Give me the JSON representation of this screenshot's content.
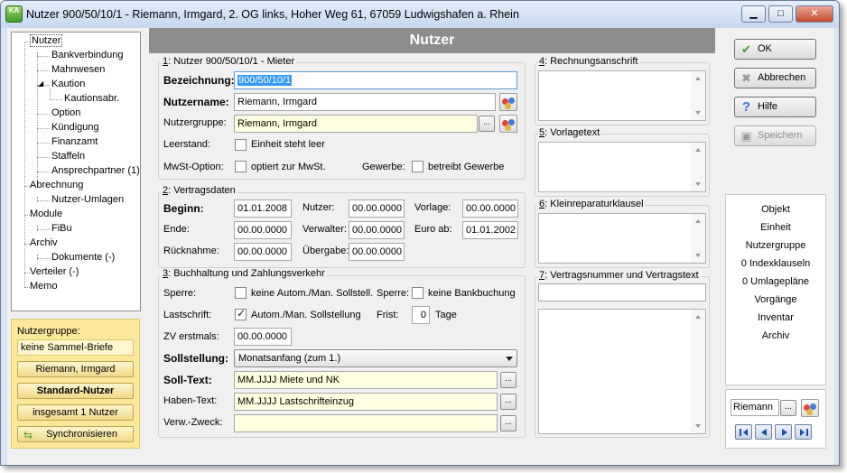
{
  "window": {
    "title": "Nutzer 900/50/10/1 - Riemann, Irmgard, 2. OG links, Hoher Weg 61, 67059 Ludwigshafen a. Rhein",
    "app_icon_text": "KA",
    "minimize": "▁",
    "maximize": "□",
    "close": "✕"
  },
  "tree": {
    "items": [
      {
        "label": "Nutzer",
        "level": 0
      },
      {
        "label": "Bankverbindung",
        "level": 1
      },
      {
        "label": "Mahnwesen",
        "level": 1
      },
      {
        "label": "Kaution",
        "level": 1
      },
      {
        "label": "Kautionsabr.",
        "level": 2
      },
      {
        "label": "Option",
        "level": 1
      },
      {
        "label": "Kündigung",
        "level": 1
      },
      {
        "label": "Finanzamt",
        "level": 1
      },
      {
        "label": "Staffeln",
        "level": 1
      },
      {
        "label": "Ansprechpartner (1)",
        "level": 1
      },
      {
        "label": "Abrechnung",
        "level": 0
      },
      {
        "label": "Nutzer-Umlagen",
        "level": 1
      },
      {
        "label": "Module",
        "level": 0
      },
      {
        "label": "FiBu",
        "level": 1
      },
      {
        "label": "Archiv",
        "level": 0
      },
      {
        "label": "Dokumente (-)",
        "level": 1
      },
      {
        "label": "Verteiler (-)",
        "level": 0
      },
      {
        "label": "Memo",
        "level": 0
      }
    ],
    "expander": "◢"
  },
  "nutzergruppe_panel": {
    "label": "Nutzergruppe:",
    "sammel_briefe": "keine Sammel-Briefe",
    "riemann_button": "Riemann, Irmgard",
    "standard_button": "Standard-Nutzer",
    "insgesamt_button": "insgesamt 1 Nutzer",
    "sync_button": "Synchronisieren"
  },
  "main": {
    "header": "Nutzer",
    "section1": {
      "title_num": "1",
      "title_rest": ": Nutzer 900/50/10/1 - Mieter",
      "bezeichnung_label": "Bezeichnung:",
      "bezeichnung_value": "900/50/10/1",
      "nutzername_label": "Nutzername:",
      "nutzername_value": "Riemann, Irmgard",
      "nutzergruppe_label": "Nutzergruppe:",
      "nutzergruppe_value": "Riemann, Irmgard",
      "leerstand_label": "Leerstand:",
      "leerstand_cb": "Einheit steht leer",
      "mwst_label": "MwSt-Option:",
      "mwst_cb": "optiert zur MwSt.",
      "gewerbe_label": "Gewerbe:",
      "gewerbe_cb": "betreibt Gewerbe"
    },
    "section2": {
      "title_num": "2",
      "title_rest": ": Vertragsdaten",
      "beginn_label": "Beginn:",
      "beginn_value": "01.01.2008",
      "ende_label": "Ende:",
      "ende_value": "00.00.0000",
      "ruecknahme_label": "Rücknahme:",
      "ruecknahme_value": "00.00.0000",
      "nutzer_label": "Nutzer:",
      "nutzer_value": "00.00.0000",
      "verwalter_label": "Verwalter:",
      "verwalter_value": "00.00.0000",
      "uebergabe_label": "Übergabe:",
      "uebergabe_value": "00.00.0000",
      "vorlage_label": "Vorlage:",
      "vorlage_value": "00.00.0000",
      "euro_label": "Euro ab:",
      "euro_value": "01.01.2002"
    },
    "section3": {
      "title_num": "3",
      "title_rest": ": Buchhaltung und Zahlungsverkehr",
      "sperre_label": "Sperre:",
      "sperre_cb": "keine Autom./Man. Sollstell.",
      "sperre2_label": "Sperre:",
      "sperre2_cb": "keine Bankbuchung",
      "lastschrift_label": "Lastschrift:",
      "lastschrift_cb": "Autom./Man. Sollstellung",
      "frist_label": "Frist:",
      "frist_value": "0",
      "tage_label": "Tage",
      "zv_label": "ZV erstmals:",
      "zv_value": "00.00.0000",
      "sollstellung_label": "Sollstellung:",
      "sollstellung_value": "Monatsanfang (zum 1.)",
      "soll_label": "Soll-Text:",
      "soll_value": "MM.JJJJ Miete und NK",
      "haben_label": "Haben-Text:",
      "haben_value": "MM.JJJJ Lastschrifteinzug",
      "verw_label": "Verw.-Zweck:",
      "verw_value": ""
    },
    "dots": "...",
    "section4": {
      "title_num": "4",
      "title_rest": ": Rechnungsanschrift"
    },
    "section5": {
      "title_num": "5",
      "title_rest": ": Vorlagetext"
    },
    "section6": {
      "title_num": "6",
      "title_rest": ": Kleinreparaturklausel"
    },
    "section7": {
      "title_num": "7",
      "title_rest": ": Vertragsnummer und Vertragstext",
      "vertragsnummer_value": ""
    }
  },
  "buttons": {
    "ok": "OK",
    "abbrechen": "Abbrechen",
    "hilfe": "Hilfe",
    "speichern": "Speichern"
  },
  "links": [
    "Objekt",
    "Einheit",
    "Nutzergruppe",
    "0 Indexklauseln",
    "0 Umlagepläne",
    "Vorgänge",
    "Inventar",
    "Archiv"
  ],
  "navigator": {
    "name_value": "Riemann",
    "dots": "..."
  },
  "colors": {
    "selection": "#3399ff",
    "header_gray": "#8d8d8d",
    "yellow_field": "#ffffe1",
    "yellow_panel": "#fbe89a"
  }
}
